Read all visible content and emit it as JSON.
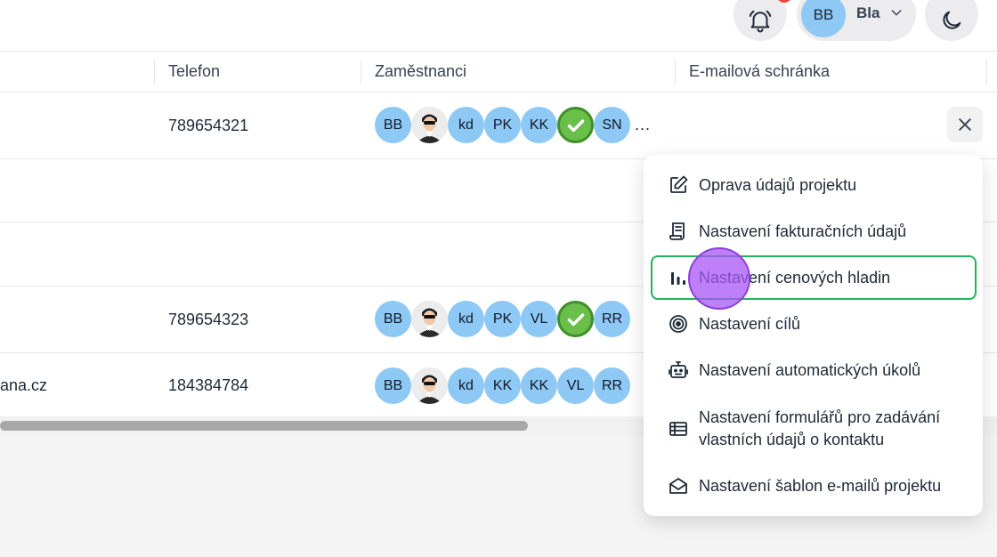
{
  "header": {
    "user_initials": "BB",
    "user_name": "Bla"
  },
  "table": {
    "columns": [
      "Telefon",
      "Zaměstnanci",
      "E-mailová schránka"
    ],
    "rows": [
      {
        "email_fragment": "",
        "phone": "789654321",
        "employees": [
          "BB",
          "photo",
          "kd",
          "PK",
          "KK",
          "check",
          "SN"
        ],
        "more": "..."
      },
      {
        "email_fragment": "",
        "phone": "",
        "employees": []
      },
      {
        "email_fragment": "",
        "phone": "",
        "employees": []
      },
      {
        "email_fragment": "",
        "phone": "789654323",
        "employees": [
          "BB",
          "photo",
          "kd",
          "PK",
          "VL",
          "check",
          "RR"
        ]
      },
      {
        "email_fragment": "ana.cz",
        "phone": "184384784",
        "employees": [
          "BB",
          "photo",
          "kd",
          "KK",
          "KK",
          "VL",
          "RR"
        ]
      }
    ]
  },
  "menu": {
    "items": [
      {
        "label": "Oprava údajů projektu",
        "icon": "edit-icon"
      },
      {
        "label": "Nastavení fakturačních údajů",
        "icon": "receipt-icon"
      },
      {
        "label": "Nastavení cenových hladin",
        "icon": "bar-chart-icon",
        "active": true
      },
      {
        "label": "Nastavení cílů",
        "icon": "target-icon"
      },
      {
        "label": "Nastavení automatických úkolů",
        "icon": "robot-icon"
      },
      {
        "label": "Nastavení formulářů pro zadávání vlastních údajů o kontaktu",
        "icon": "table-list-icon"
      },
      {
        "label": "Nastavení šablon e-mailů projektu",
        "icon": "mail-open-icon"
      }
    ]
  },
  "colors": {
    "avatar": "#8ec8f5",
    "active_border": "#22b35a",
    "check": "#6abf4b",
    "cursor": "#a855f7"
  }
}
